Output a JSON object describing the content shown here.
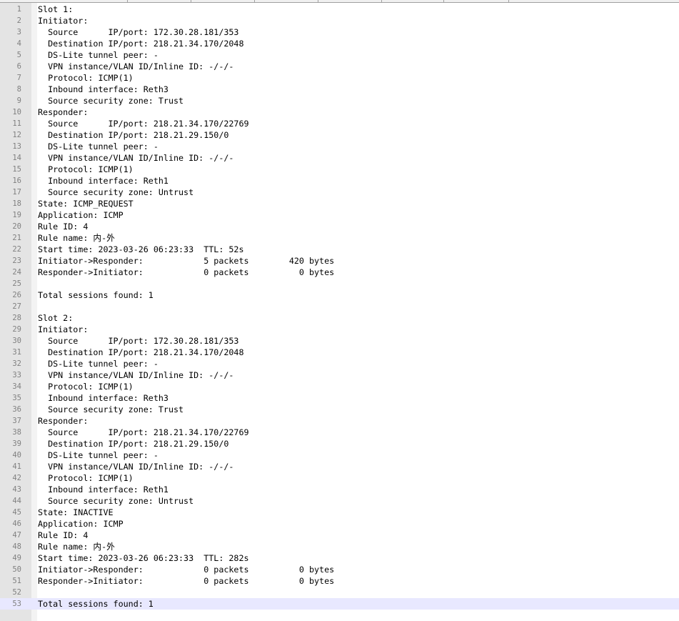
{
  "editor": {
    "current_line": 53,
    "lines": [
      {
        "n": "1",
        "text": "Slot 1:"
      },
      {
        "n": "2",
        "text": "Initiator:"
      },
      {
        "n": "3",
        "text": "  Source      IP/port: 172.30.28.181/353"
      },
      {
        "n": "4",
        "text": "  Destination IP/port: 218.21.34.170/2048"
      },
      {
        "n": "5",
        "text": "  DS-Lite tunnel peer: -"
      },
      {
        "n": "6",
        "text": "  VPN instance/VLAN ID/Inline ID: -/-/-"
      },
      {
        "n": "7",
        "text": "  Protocol: ICMP(1)"
      },
      {
        "n": "8",
        "text": "  Inbound interface: Reth3"
      },
      {
        "n": "9",
        "text": "  Source security zone: Trust"
      },
      {
        "n": "10",
        "text": "Responder:"
      },
      {
        "n": "11",
        "text": "  Source      IP/port: 218.21.34.170/22769"
      },
      {
        "n": "12",
        "text": "  Destination IP/port: 218.21.29.150/0"
      },
      {
        "n": "13",
        "text": "  DS-Lite tunnel peer: -"
      },
      {
        "n": "14",
        "text": "  VPN instance/VLAN ID/Inline ID: -/-/-"
      },
      {
        "n": "15",
        "text": "  Protocol: ICMP(1)"
      },
      {
        "n": "16",
        "text": "  Inbound interface: Reth1"
      },
      {
        "n": "17",
        "text": "  Source security zone: Untrust"
      },
      {
        "n": "18",
        "text": "State: ICMP_REQUEST"
      },
      {
        "n": "19",
        "text": "Application: ICMP"
      },
      {
        "n": "20",
        "text": "Rule ID: 4"
      },
      {
        "n": "21",
        "text": "Rule name: 内-外"
      },
      {
        "n": "22",
        "text": "Start time: 2023-03-26 06:23:33  TTL: 52s"
      },
      {
        "n": "23",
        "text": "Initiator->Responder:            5 packets        420 bytes"
      },
      {
        "n": "24",
        "text": "Responder->Initiator:            0 packets          0 bytes"
      },
      {
        "n": "25",
        "text": ""
      },
      {
        "n": "26",
        "text": "Total sessions found: 1"
      },
      {
        "n": "27",
        "text": ""
      },
      {
        "n": "28",
        "text": "Slot 2:"
      },
      {
        "n": "29",
        "text": "Initiator:"
      },
      {
        "n": "30",
        "text": "  Source      IP/port: 172.30.28.181/353"
      },
      {
        "n": "31",
        "text": "  Destination IP/port: 218.21.34.170/2048"
      },
      {
        "n": "32",
        "text": "  DS-Lite tunnel peer: -"
      },
      {
        "n": "33",
        "text": "  VPN instance/VLAN ID/Inline ID: -/-/-"
      },
      {
        "n": "34",
        "text": "  Protocol: ICMP(1)"
      },
      {
        "n": "35",
        "text": "  Inbound interface: Reth3"
      },
      {
        "n": "36",
        "text": "  Source security zone: Trust"
      },
      {
        "n": "37",
        "text": "Responder:"
      },
      {
        "n": "38",
        "text": "  Source      IP/port: 218.21.34.170/22769"
      },
      {
        "n": "39",
        "text": "  Destination IP/port: 218.21.29.150/0"
      },
      {
        "n": "40",
        "text": "  DS-Lite tunnel peer: -"
      },
      {
        "n": "41",
        "text": "  VPN instance/VLAN ID/Inline ID: -/-/-"
      },
      {
        "n": "42",
        "text": "  Protocol: ICMP(1)"
      },
      {
        "n": "43",
        "text": "  Inbound interface: Reth1"
      },
      {
        "n": "44",
        "text": "  Source security zone: Untrust"
      },
      {
        "n": "45",
        "text": "State: INACTIVE"
      },
      {
        "n": "46",
        "text": "Application: ICMP"
      },
      {
        "n": "47",
        "text": "Rule ID: 4"
      },
      {
        "n": "48",
        "text": "Rule name: 内-外"
      },
      {
        "n": "49",
        "text": "Start time: 2023-03-26 06:23:33  TTL: 282s"
      },
      {
        "n": "50",
        "text": "Initiator->Responder:            0 packets          0 bytes"
      },
      {
        "n": "51",
        "text": "Responder->Initiator:            0 packets          0 bytes"
      },
      {
        "n": "52",
        "text": ""
      },
      {
        "n": "53",
        "text": "Total sessions found: 1"
      }
    ]
  }
}
